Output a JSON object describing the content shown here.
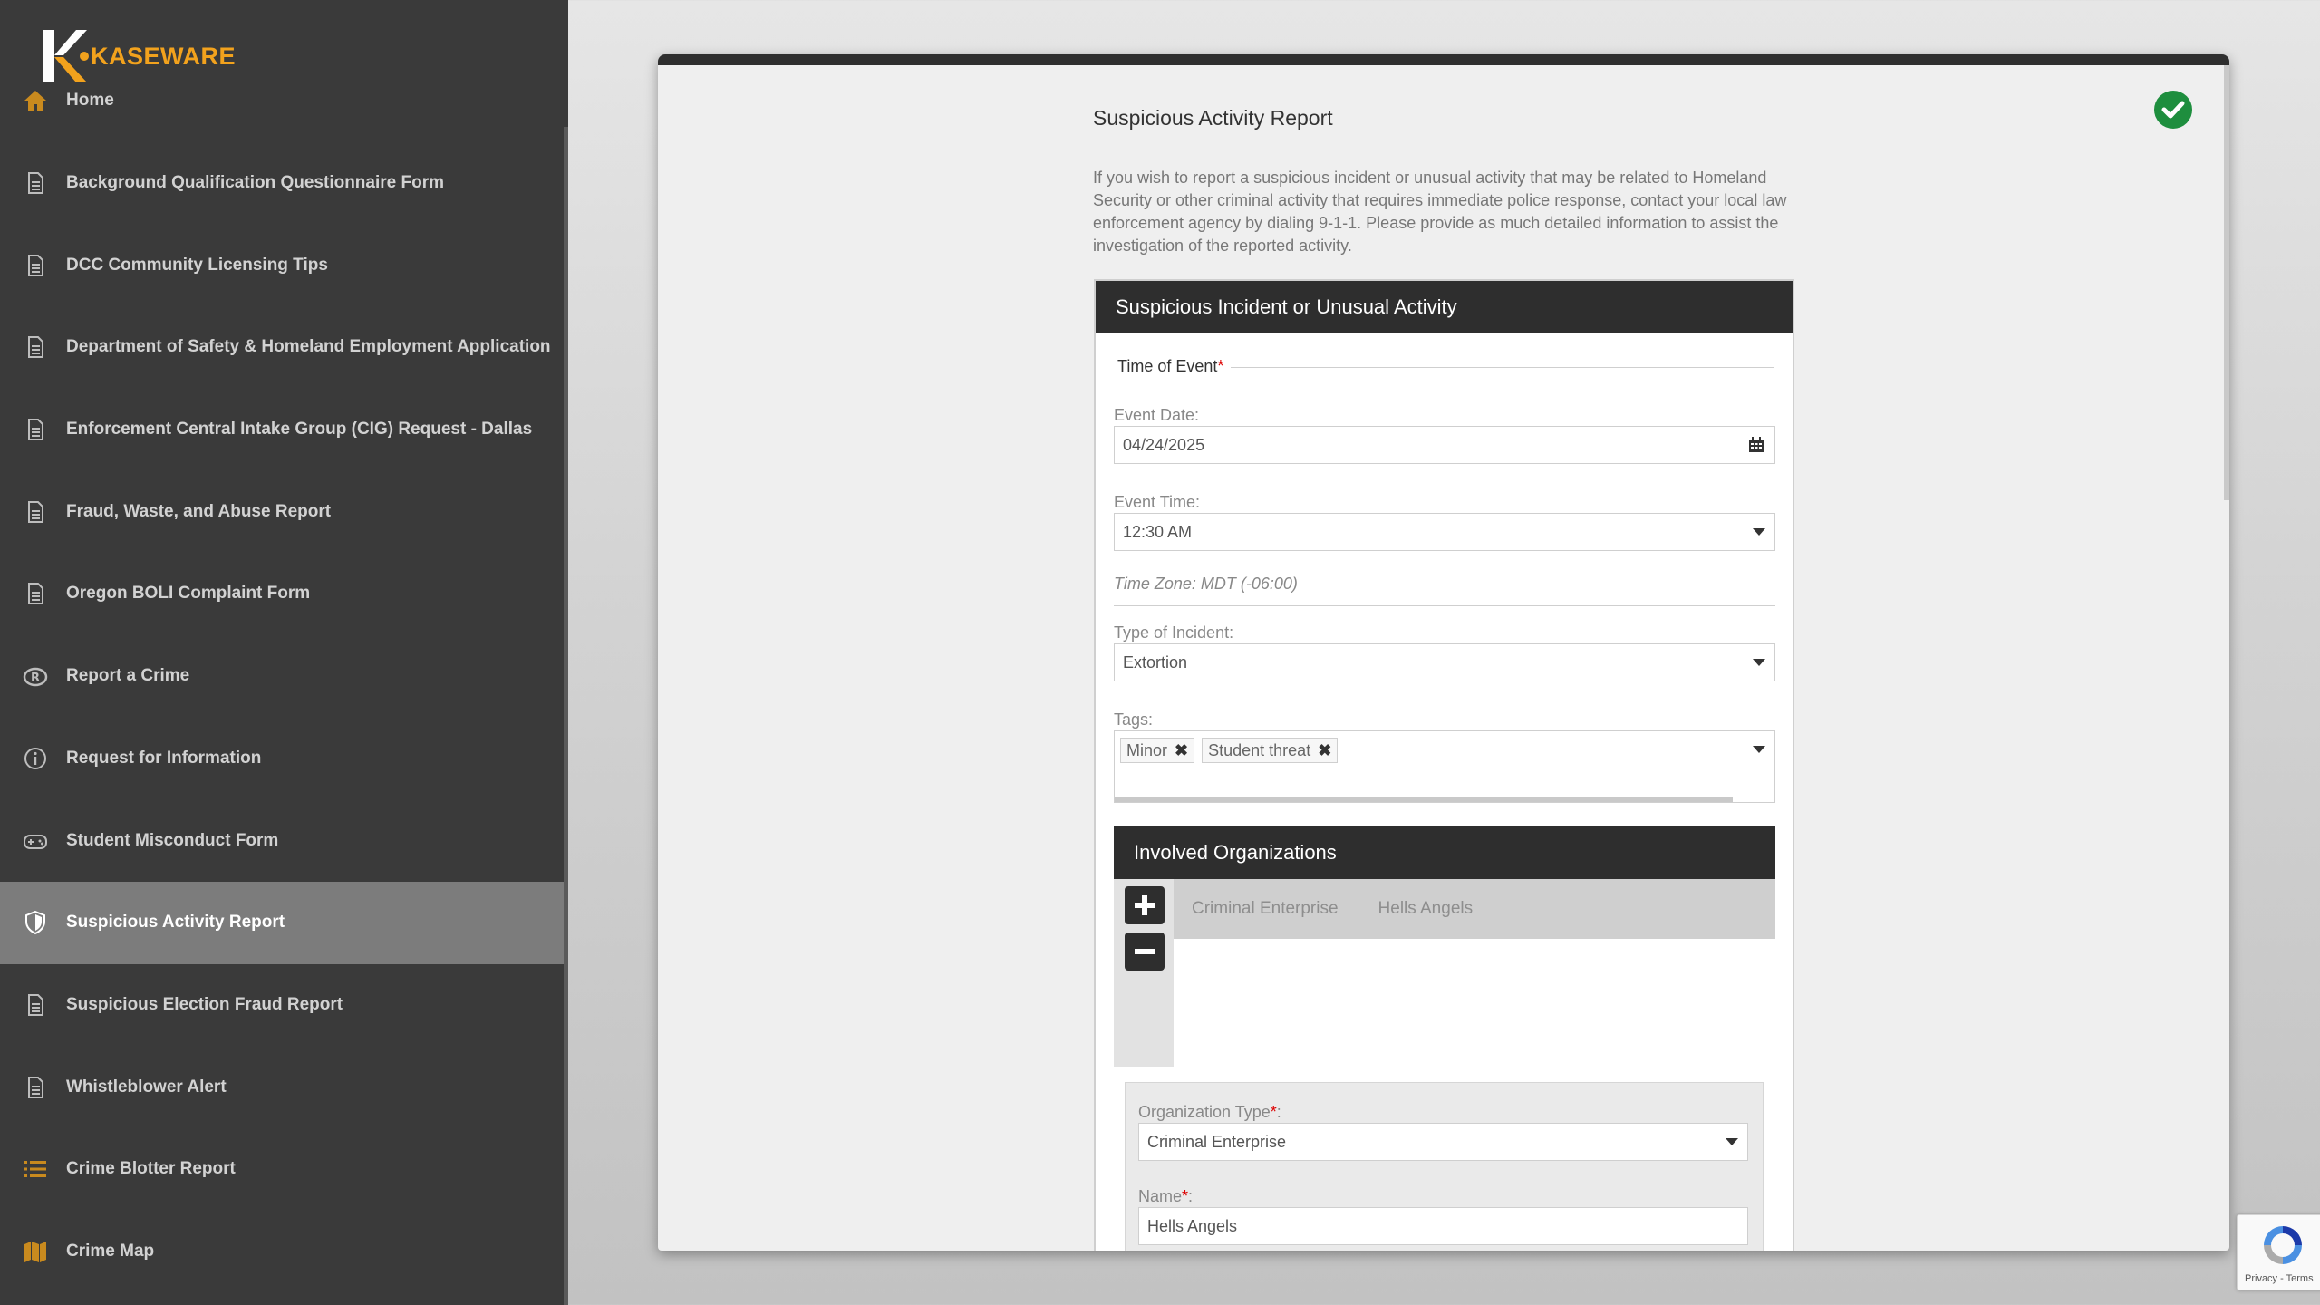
{
  "app": {
    "brand": "KASEWARE",
    "brand_color": "#f2a21d"
  },
  "sidebar": {
    "items": [
      {
        "label": "Home",
        "icon": "home-icon",
        "active": false
      },
      {
        "label": "Background Qualification Questionnaire Form",
        "icon": "document-icon",
        "active": false
      },
      {
        "label": "DCC Community Licensing Tips",
        "icon": "document-icon",
        "active": false
      },
      {
        "label": "Department of Safety & Homeland Employment Application",
        "icon": "document-icon",
        "active": false
      },
      {
        "label": "Enforcement Central Intake Group (CIG) Request - Dallas",
        "icon": "document-icon",
        "active": false
      },
      {
        "label": "Fraud, Waste, and Abuse Report",
        "icon": "document-icon",
        "active": false
      },
      {
        "label": "Oregon BOLI Complaint Form",
        "icon": "document-icon",
        "active": false
      },
      {
        "label": "Report a Crime",
        "icon": "report-icon",
        "active": false
      },
      {
        "label": "Request for Information",
        "icon": "info-icon",
        "active": false
      },
      {
        "label": "Student Misconduct Form",
        "icon": "gamepad-icon",
        "active": false
      },
      {
        "label": "Suspicious Activity Report",
        "icon": "shield-icon",
        "active": true
      },
      {
        "label": "Suspicious Election Fraud Report",
        "icon": "document-icon",
        "active": false
      },
      {
        "label": "Whistleblower Alert",
        "icon": "document-icon",
        "active": false
      },
      {
        "label": "Crime Blotter Report",
        "icon": "list-icon",
        "active": false
      },
      {
        "label": "Crime Map",
        "icon": "map-icon",
        "active": false
      }
    ]
  },
  "form": {
    "title": "Suspicious Activity Report",
    "intro": "If you wish to report a suspicious incident or unusual activity that may be related to Homeland Security or other criminal activity that requires immediate police response, contact your local law enforcement agency by dialing 9-1-1. Please provide as much detailed information to assist the investigation of the reported activity.",
    "panel_title": "Suspicious Incident or Unusual Activity",
    "time_section": "Time of Event",
    "required_mark": "*",
    "event_date_label": "Event Date:",
    "event_date_value": "04/24/2025",
    "event_time_label": "Event Time:",
    "event_time_value": "12:30 AM",
    "time_zone": "Time Zone: MDT (-06:00)",
    "incident_type_label": "Type of Incident:",
    "incident_type_value": "Extortion",
    "tags_label": "Tags:",
    "tags": [
      "Minor",
      "Student threat"
    ],
    "orgs_title": "Involved Organizations",
    "org_tabs": [
      "Criminal Enterprise",
      "Hells Angels"
    ],
    "org_type_label": "Organization Type",
    "org_type_suffix": ":",
    "org_type_value": "Criminal Enterprise",
    "org_name_label": "Name",
    "org_name_suffix": ":",
    "org_name_value": "Hells Angels"
  },
  "recaptcha": {
    "text": "Privacy - Terms"
  },
  "colors": {
    "success": "#1e8e3e",
    "sidebar_bg": "#3a3a3a",
    "active_item": "#7c7c7c",
    "header_dark": "#2e2e2e"
  }
}
